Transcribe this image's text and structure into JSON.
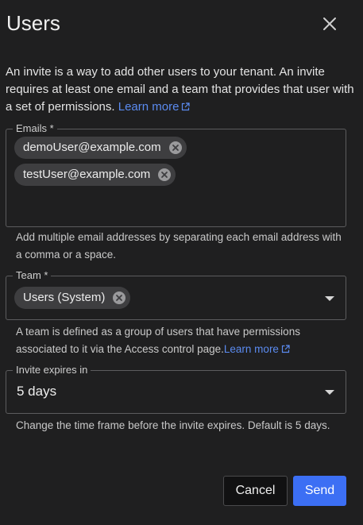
{
  "dialog": {
    "title": "Users",
    "intro_text": "An invite is a way to add other users to your tenant. An invite requires at least one email and a team that provides that user with a set of permissions. ",
    "intro_link": "Learn more"
  },
  "emails": {
    "label": "Emails *",
    "chips": [
      "demoUser@example.com",
      "testUser@example.com"
    ],
    "helper": "Add multiple email addresses by separating each email address with a comma or a space."
  },
  "team": {
    "label": "Team *",
    "chips": [
      "Users (System)"
    ],
    "helper_text": "A team is defined as a group of users that have permissions associated to it via the Access control page.",
    "helper_link": "Learn more"
  },
  "expires": {
    "label": "Invite expires in",
    "value": "5 days",
    "helper": "Change the time frame before the invite expires. Default is 5 days."
  },
  "actions": {
    "cancel_label": "Cancel",
    "send_label": "Send"
  },
  "icons": {
    "close": "close-icon",
    "chip_remove": "chip-remove-icon",
    "external_link": "external-link-icon",
    "dropdown": "chevron-down-icon"
  },
  "colors": {
    "background": "#1f1f20",
    "accent": "#3c6ff4",
    "link": "#5b8bf0",
    "chip": "#3e3e40"
  }
}
